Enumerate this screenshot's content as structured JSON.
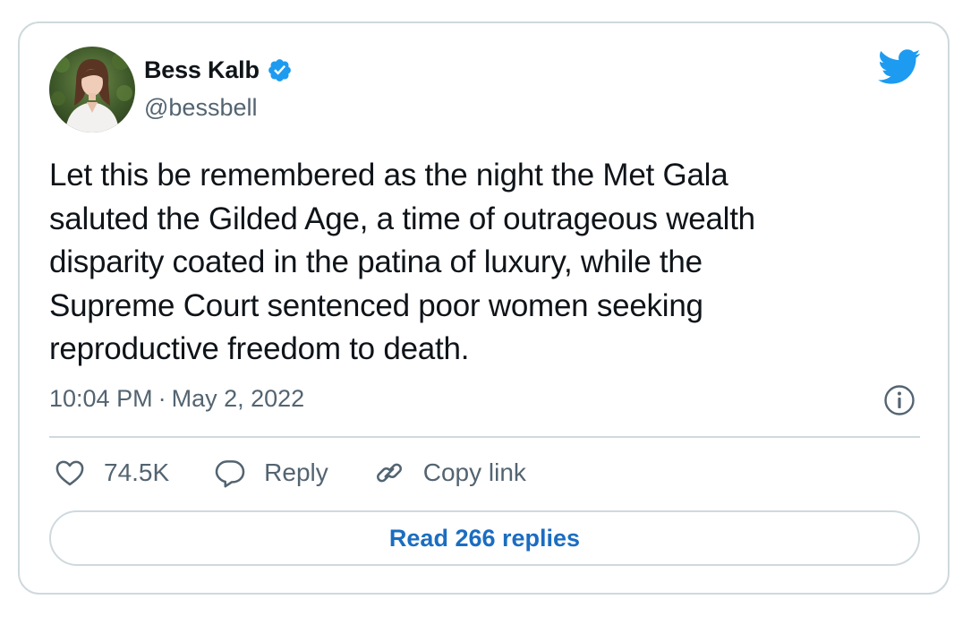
{
  "author": {
    "display_name": "Bess Kalb",
    "handle": "@bessbell",
    "verified_icon": "verified-badge-icon",
    "avatar": "avatar"
  },
  "brand": {
    "icon": "twitter-bird-icon",
    "color": "#1d9bf0"
  },
  "tweet": {
    "text": "Let this be remembered as the night the Met Gala\nsaluted the Gilded Age, a time of outrageous wealth\ndisparity coated in the patina of luxury, while the\nSupreme Court sentenced poor women seeking\nreproductive freedom to death.",
    "time": "10:04 PM",
    "separator": "·",
    "date": "May 2, 2022"
  },
  "actions": {
    "likes_icon": "heart-icon",
    "likes_count": "74.5K",
    "reply_icon": "reply-bubble-icon",
    "reply_label": "Reply",
    "copy_icon": "link-icon",
    "copy_label": "Copy link"
  },
  "replies_button": {
    "label": "Read 266 replies",
    "color": "#1b6dc1"
  },
  "colors": {
    "text": "#0f1419",
    "secondary": "#536471",
    "border": "#cfd9de"
  }
}
